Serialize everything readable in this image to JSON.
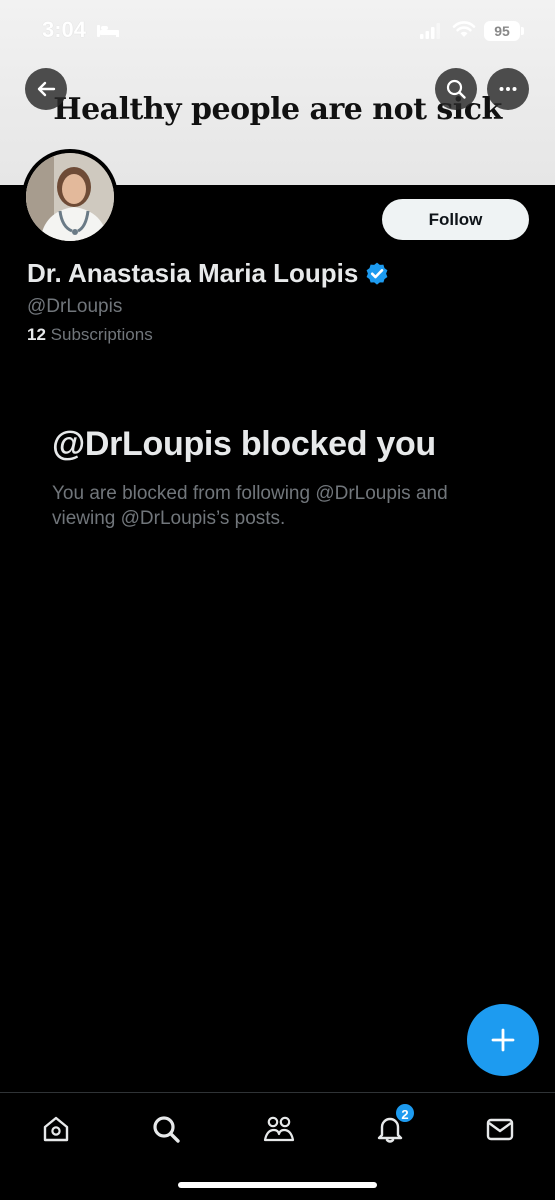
{
  "status_bar": {
    "time": "3:04",
    "battery": "95"
  },
  "banner": {
    "text": "Healthy people are not sick"
  },
  "profile": {
    "display_name": "Dr. Anastasia Maria Loupis",
    "handle": "@DrLoupis",
    "subscriptions_count": "12",
    "subscriptions_label": "Subscriptions",
    "follow_label": "Follow",
    "verified": true
  },
  "blocked": {
    "title": "@DrLoupis blocked you",
    "description": "You are blocked from following @DrLoupis and viewing @DrLoupis’s posts."
  },
  "tabbar": {
    "items": [
      {
        "name": "home-icon"
      },
      {
        "name": "search-icon"
      },
      {
        "name": "communities-icon"
      },
      {
        "name": "notifications-icon"
      },
      {
        "name": "messages-icon"
      }
    ],
    "notifications_badge": "2"
  },
  "colors": {
    "accent": "#1d9bf0",
    "background": "#000000",
    "secondary_text": "#71767b",
    "primary_text": "#e7e9ea"
  },
  "icons": {
    "back": "arrow-left-icon",
    "search": "search-icon",
    "more": "more-icon",
    "verified": "verified-badge-icon",
    "compose": "plus-icon"
  }
}
